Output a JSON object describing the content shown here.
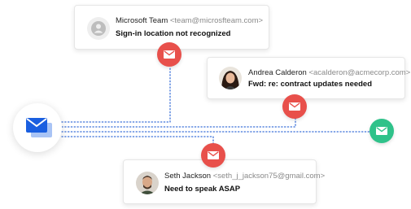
{
  "colors": {
    "alert_red": "#e8504b",
    "safe_green": "#2fc28a",
    "hub_blue": "#1a5fe0",
    "dot_line": "#3a6fd8"
  },
  "hub": {
    "icon": "envelope-stack-icon"
  },
  "emails": [
    {
      "sender_name": "Microsoft Team",
      "sender_email": "<team@microsfteam.com>",
      "subject": "Sign-in location not recognized",
      "avatar": "generic-user-avatar",
      "status": "alert"
    },
    {
      "sender_name": "Andrea Calderon",
      "sender_email": "<acalderon@acmecorp.com>",
      "subject": "Fwd: re: contract updates needed",
      "avatar": "andrea-photo-avatar",
      "status": "alert"
    },
    {
      "sender_name": "Seth Jackson",
      "sender_email": "<seth_j_jackson75@gmail.com>",
      "subject": "Need to speak ASAP",
      "avatar": "seth-photo-avatar",
      "status": "alert"
    }
  ],
  "safe_badge": {
    "icon": "mail-icon",
    "status": "safe"
  }
}
